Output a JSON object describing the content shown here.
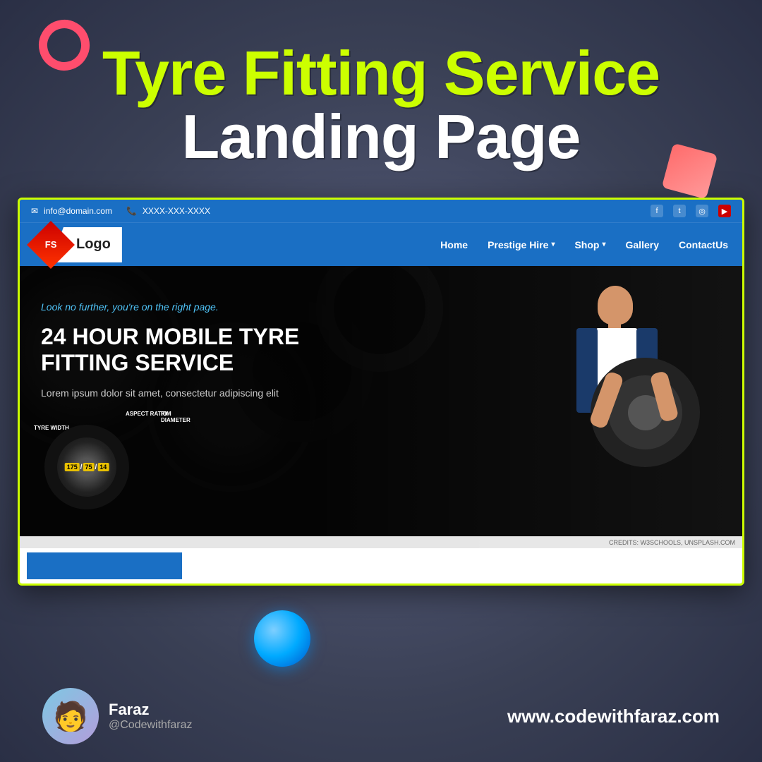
{
  "page": {
    "background_color": "#4a5068"
  },
  "hero_text": {
    "title_line1": "Tyre Fitting Service",
    "title_line2": "Landing Page"
  },
  "topbar": {
    "email": "info@domain.com",
    "phone": "XXXX-XXX-XXXX"
  },
  "navbar": {
    "logo_initials": "FS",
    "logo_name": "Logo",
    "links": [
      {
        "label": "Home"
      },
      {
        "label": "Prestige Hire ▾"
      },
      {
        "label": "Shop ▾"
      },
      {
        "label": "Gallery"
      },
      {
        "label": "ContactUs"
      }
    ]
  },
  "hero": {
    "subtitle": "Look no further, you're on the right page.",
    "title": "24 HOUR MOBILE TYRE FITTING SERVICE",
    "description": "Lorem ipsum dolor sit amet, consectetur adipiscing elit",
    "tyre_numbers": {
      "width": "175",
      "aspect": "75",
      "rim": "14"
    },
    "credits": "CREDITS: W3SCHOOLS, UNSPLASH.COM"
  },
  "footer": {
    "author_name": "Faraz",
    "author_handle": "@Codewithfaraz",
    "website": "www.codewithfaraz.com"
  },
  "decorations": {
    "ring_color": "#ff4d6d",
    "diamond_color": "#ff8877",
    "sphere_color": "#00aaff"
  }
}
